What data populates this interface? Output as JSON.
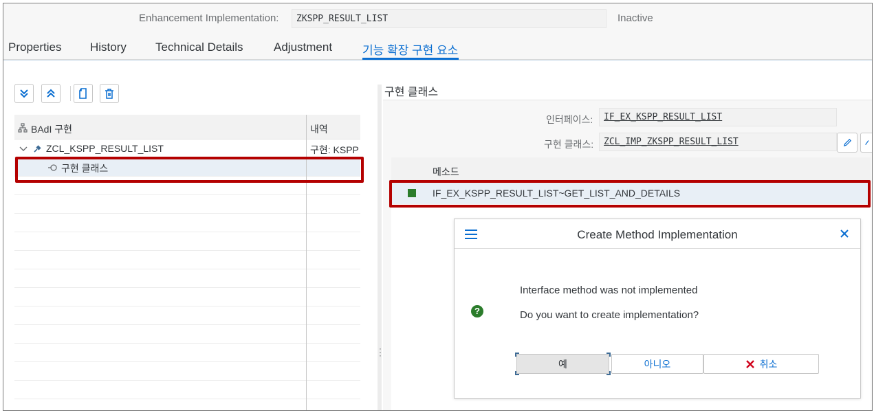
{
  "header": {
    "enh_label": "Enhancement Implementation:",
    "enh_value": "ZKSPP_RESULT_LIST",
    "status": "Inactive"
  },
  "tabs": [
    {
      "label": "Properties"
    },
    {
      "label": "History"
    },
    {
      "label": "Technical Details"
    },
    {
      "label": "Adjustment"
    },
    {
      "label": "기능 확장 구현 요소",
      "selected": true
    }
  ],
  "toolbar": {
    "icons": [
      "expand-all-icon",
      "collapse-all-icon",
      "document-icon",
      "trash-icon"
    ]
  },
  "tree": {
    "col_badi": "BAdI 구현",
    "col_desc": "내역",
    "rows": [
      {
        "label": "ZCL_KSPP_RESULT_LIST",
        "desc": "구현: KSPP"
      },
      {
        "label": "구현 클래스",
        "desc": ""
      }
    ]
  },
  "right": {
    "title": "구현 클래스",
    "interface_label": "인터페이스:",
    "interface_value": "IF_EX_KSPP_RESULT_LIST",
    "class_label": "구현 클래스:",
    "class_value": "ZCL_IMP_ZKSPP_RESULT_LIST",
    "method_col": "메소드",
    "method_row": "IF_EX_KSPP_RESULT_LIST~GET_LIST_AND_DETAILS"
  },
  "dialog": {
    "title": "Create Method Implementation",
    "msg1": "Interface method was not implemented",
    "msg2": "Do you want to create implementation?",
    "btn_yes": "예",
    "btn_no": "아니오",
    "btn_cancel": "취소"
  },
  "colors": {
    "accent": "#0a6ed1",
    "highlight": "#b40000",
    "ok_green": "#2b7c2b"
  }
}
